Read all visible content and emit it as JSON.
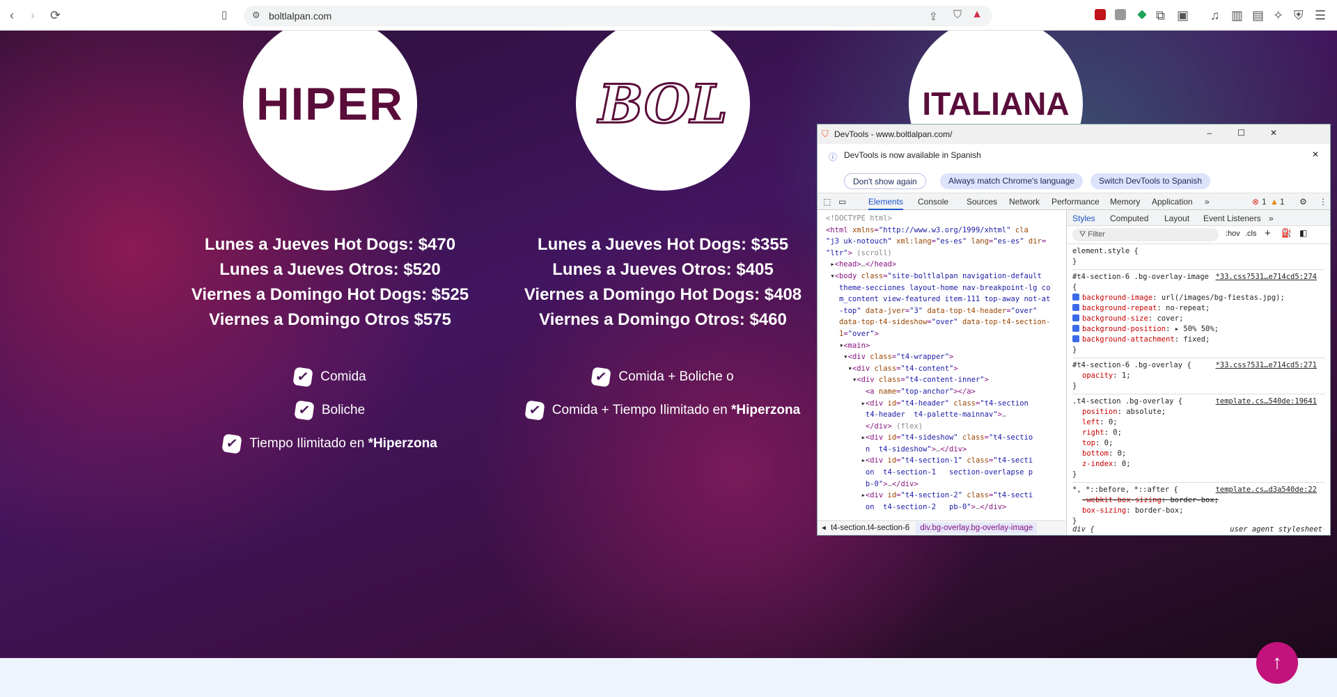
{
  "browser": {
    "url": "boltlalpan.com",
    "back": "‹",
    "forward": "›",
    "reload": "⟳"
  },
  "logos": [
    "HIPER",
    "BOL",
    "ITALIANA"
  ],
  "columns": [
    {
      "prices": [
        "Lunes a Jueves Hot Dogs: $470",
        "Lunes a Jueves Otros: $520",
        "Viernes a Domingo Hot Dogs: $525",
        "Viernes a Domingo Otros $575"
      ],
      "features": [
        {
          "text": "Comida",
          "bold": ""
        },
        {
          "text": "Boliche",
          "bold": ""
        },
        {
          "text": "Tiempo Ilimitado en ",
          "bold": "*Hiperzona"
        }
      ]
    },
    {
      "prices": [
        "Lunes a Jueves Hot Dogs: $355",
        "Lunes a Jueves Otros: $405",
        "Viernes a Domingo Hot Dogs: $408",
        "Viernes a Domingo Otros: $460"
      ],
      "features": [
        {
          "text": "Comida + Boliche o",
          "bold": ""
        },
        {
          "text": "Comida + Tiempo Ilimitado en ",
          "bold": "*Hiperzona"
        }
      ]
    }
  ],
  "scroll_top": "↑",
  "devtools": {
    "title": "DevTools - www.boltlalpan.com/",
    "info": "DevTools is now available in Spanish",
    "buttons": [
      "Don't show again",
      "Always match Chrome's language",
      "Switch DevTools to Spanish"
    ],
    "tabs": [
      "Elements",
      "Console",
      "Sources",
      "Network",
      "Performance",
      "Memory",
      "Application"
    ],
    "errors": "1",
    "warnings": "1",
    "breadcrumbs": [
      "t4-section.t4-section-6",
      "div.bg-overlay.bg-overlay-image"
    ],
    "style_tabs": [
      "Styles",
      "Computed",
      "Layout",
      "Event Listeners"
    ],
    "filter_placeholder": "Filter",
    "hov": ":hov",
    "cls": ".cls",
    "rules": [
      {
        "selector": "element.style {",
        "source": "",
        "props": []
      },
      {
        "selector": "#t4-section-6 .bg-overlay-image {",
        "source": "*33.css?531…e714cd5:274",
        "props": [
          [
            "background-image",
            "url(/images/bg-fiestas.jpg);"
          ],
          [
            "background-repeat",
            "no-repeat;"
          ],
          [
            "background-size",
            "cover;"
          ],
          [
            "background-position",
            "▸ 50% 50%;"
          ],
          [
            "background-attachment",
            "fixed;"
          ]
        ]
      },
      {
        "selector": "#t4-section-6 .bg-overlay {",
        "source": "*33.css?531…e714cd5:271",
        "props": [
          [
            "opacity",
            "1;"
          ]
        ]
      },
      {
        "selector": ".t4-section .bg-overlay {",
        "source": "template.cs…540de:19641",
        "props": [
          [
            "position",
            "absolute;"
          ],
          [
            "left",
            "0;"
          ],
          [
            "right",
            "0;"
          ],
          [
            "top",
            "0;"
          ],
          [
            "bottom",
            "0;"
          ],
          [
            "z-index",
            "0;"
          ]
        ]
      },
      {
        "selector": "*, *::before, *::after {",
        "source": "template.cs…d3a540de:22",
        "props": [
          [
            "-webkit-box-sizing",
            "border-box;"
          ],
          [
            "box-sizing",
            "border-box;"
          ]
        ]
      }
    ],
    "last_rule": "div {",
    "last_source": "user agent stylesheet"
  }
}
